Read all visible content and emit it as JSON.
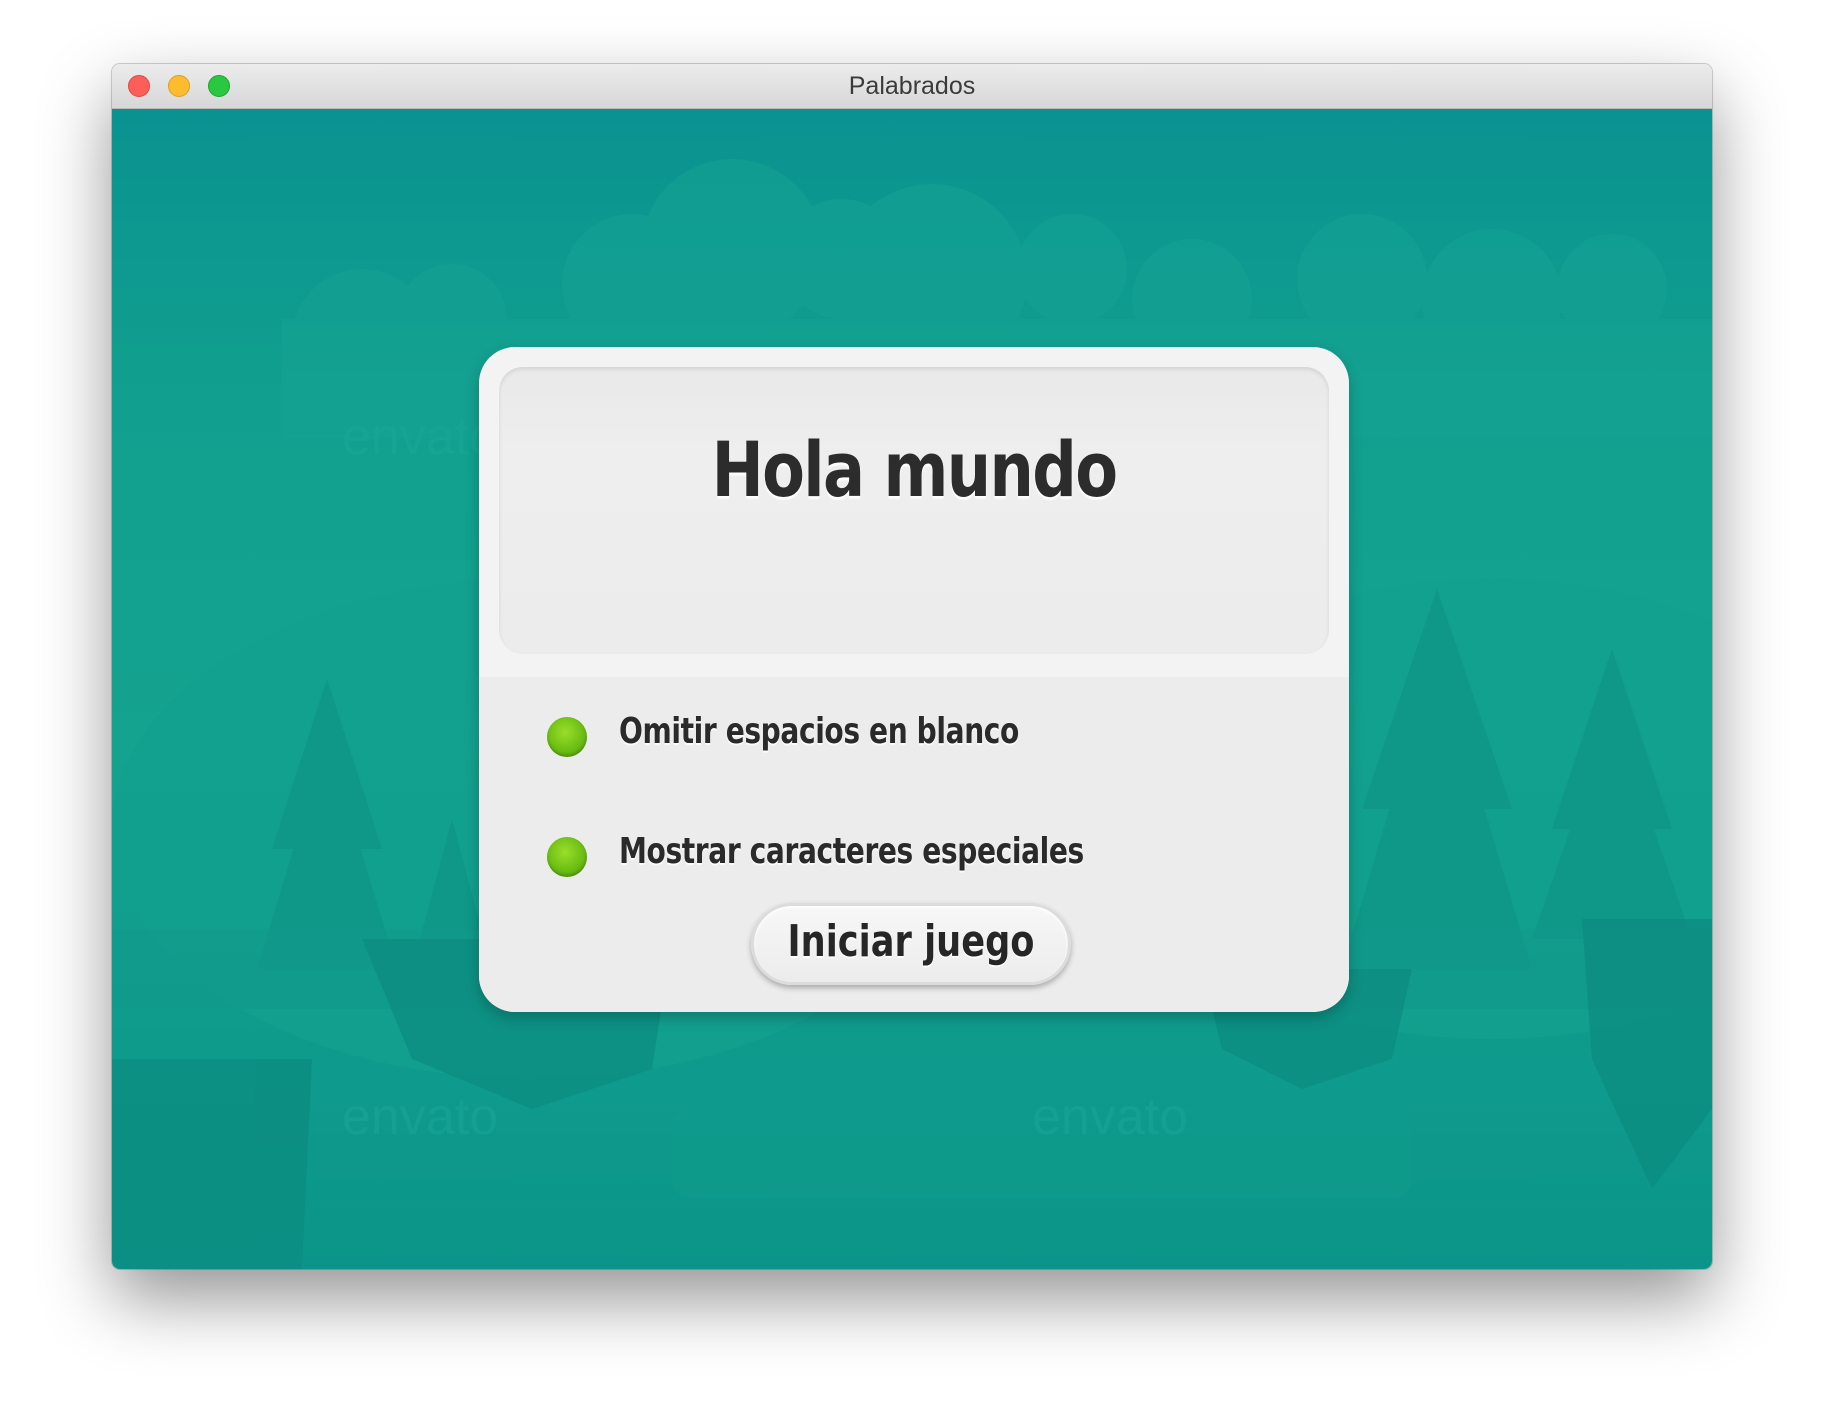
{
  "window": {
    "title": "Palabrados"
  },
  "card": {
    "title": "Hola mundo",
    "options": [
      {
        "label": "Omitir espacios en blanco",
        "enabled": true
      },
      {
        "label": "Mostrar caracteres especiales",
        "enabled": true
      }
    ],
    "start_button_label": "Iniciar juego"
  },
  "background": {
    "watermark_text": "envato"
  },
  "colors": {
    "accent_teal": "#0a9290",
    "toggle_green": "#6cbe14",
    "card_background": "#f3f3f3"
  },
  "icons": {
    "close": "close-icon",
    "minimize": "minimize-icon",
    "zoom": "zoom-icon",
    "toggle": "green-dot-icon"
  }
}
